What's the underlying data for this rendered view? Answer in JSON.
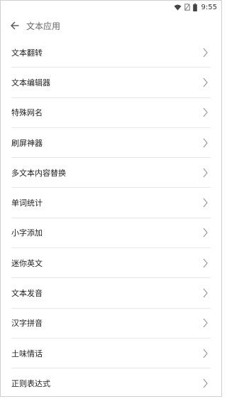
{
  "status_bar": {
    "time": "9:55",
    "icons": [
      "wifi-icon",
      "sim-off-icon",
      "battery-icon"
    ]
  },
  "header": {
    "back_icon": "arrow-left-icon",
    "title": "文本应用"
  },
  "menu": {
    "chevron_icon": "chevron-right-icon",
    "items": [
      {
        "label": "文本翻转"
      },
      {
        "label": "文本编辑器"
      },
      {
        "label": "特殊网名"
      },
      {
        "label": "刷屏神器"
      },
      {
        "label": "多文本内容替换"
      },
      {
        "label": "单词统计"
      },
      {
        "label": "小字添加"
      },
      {
        "label": "迷你英文"
      },
      {
        "label": "文本发音"
      },
      {
        "label": "汉字拼音"
      },
      {
        "label": "土味情话"
      },
      {
        "label": "正则表达式"
      }
    ]
  },
  "colors": {
    "text": "#222222",
    "title": "#666666",
    "divider": "#e8e8e8",
    "chevron": "#9a9a9a"
  }
}
